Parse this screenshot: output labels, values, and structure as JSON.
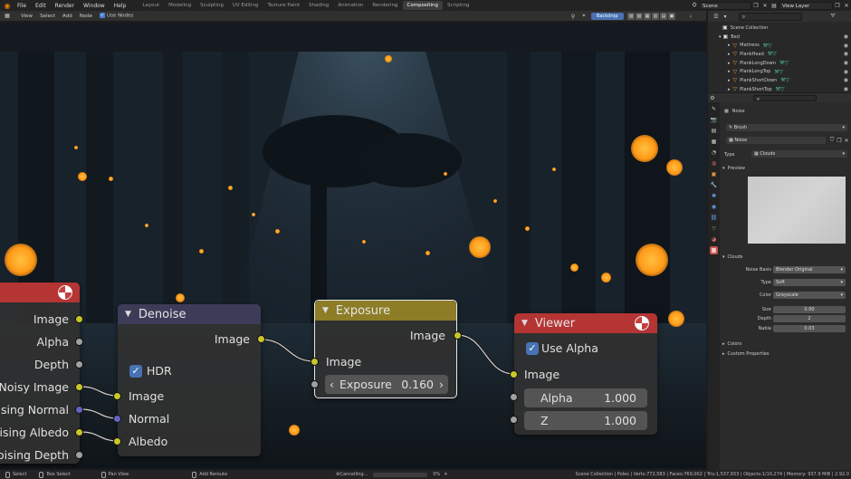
{
  "topbar": {
    "menus": [
      "File",
      "Edit",
      "Render",
      "Window",
      "Help"
    ],
    "workspaces": [
      "Layout",
      "Modeling",
      "Sculpting",
      "UV Editing",
      "Texture Paint",
      "Shading",
      "Animation",
      "Rendering",
      "Compositing",
      "Scripting"
    ],
    "active_workspace": "Compositing",
    "scene": "Scene",
    "view_layer": "View Layer"
  },
  "node_editor": {
    "menus": [
      "View",
      "Select",
      "Add",
      "Node"
    ],
    "use_nodes_label": "Use Nodes",
    "backdrop_label": "Backdrop"
  },
  "nodes": {
    "render_layers": {
      "outputs": [
        "Image",
        "Alpha",
        "Depth",
        "Noisy Image",
        "Denoising Normal",
        "Denoising Albedo",
        "Denoising Depth"
      ]
    },
    "denoise": {
      "title": "Denoise",
      "output": "Image",
      "hdr_label": "HDR",
      "inputs": [
        "Image",
        "Normal",
        "Albedo"
      ]
    },
    "exposure": {
      "title": "Exposure",
      "output": "Image",
      "input": "Image",
      "field_label": "Exposure",
      "field_value": "0.160"
    },
    "viewer": {
      "title": "Viewer",
      "use_alpha_label": "Use Alpha",
      "input": "Image",
      "alpha_label": "Alpha",
      "alpha_value": "1.000",
      "z_label": "Z",
      "z_value": "1.000"
    }
  },
  "outliner": {
    "root": "Scene Collection",
    "collection": "Bed",
    "items": [
      "Mattress",
      "PlankHead",
      "PlankLongDown",
      "PlankLongTop",
      "PlankShortDown",
      "PlankShortTop"
    ]
  },
  "properties": {
    "texture_name": "Noise",
    "brush_label": "Brush",
    "datablock": "Noise",
    "type_label": "Type",
    "type_value": "Clouds",
    "preview_label": "Preview",
    "clouds_label": "Clouds",
    "noise_basis_label": "Noise Basis",
    "noise_basis_value": "Blender Original",
    "type2_label": "Type",
    "type2_value": "Soft",
    "color_label": "Color",
    "color_value": "Grayscale",
    "size_label": "Size",
    "size_value": "0.00",
    "depth_label": "Depth",
    "depth_value": "2",
    "nabla_label": "Nabla",
    "nabla_value": "0.03",
    "colors_label": "Colors",
    "custom_props_label": "Custom Properties"
  },
  "statusbar": {
    "select": "Select",
    "box_select": "Box Select",
    "pan_view": "Pan View",
    "add_reroute": "Add Reroute",
    "cancelling": "Cancelling...",
    "progress": "0%",
    "progress_fraction": 0.0,
    "stats": "Scene Collection | Poles | Verts:772,583 | Faces:769,002 | Tris:1,537,933 | Objects:1/10,274 | Memory: 937.9 MiB | 2.92.0"
  }
}
